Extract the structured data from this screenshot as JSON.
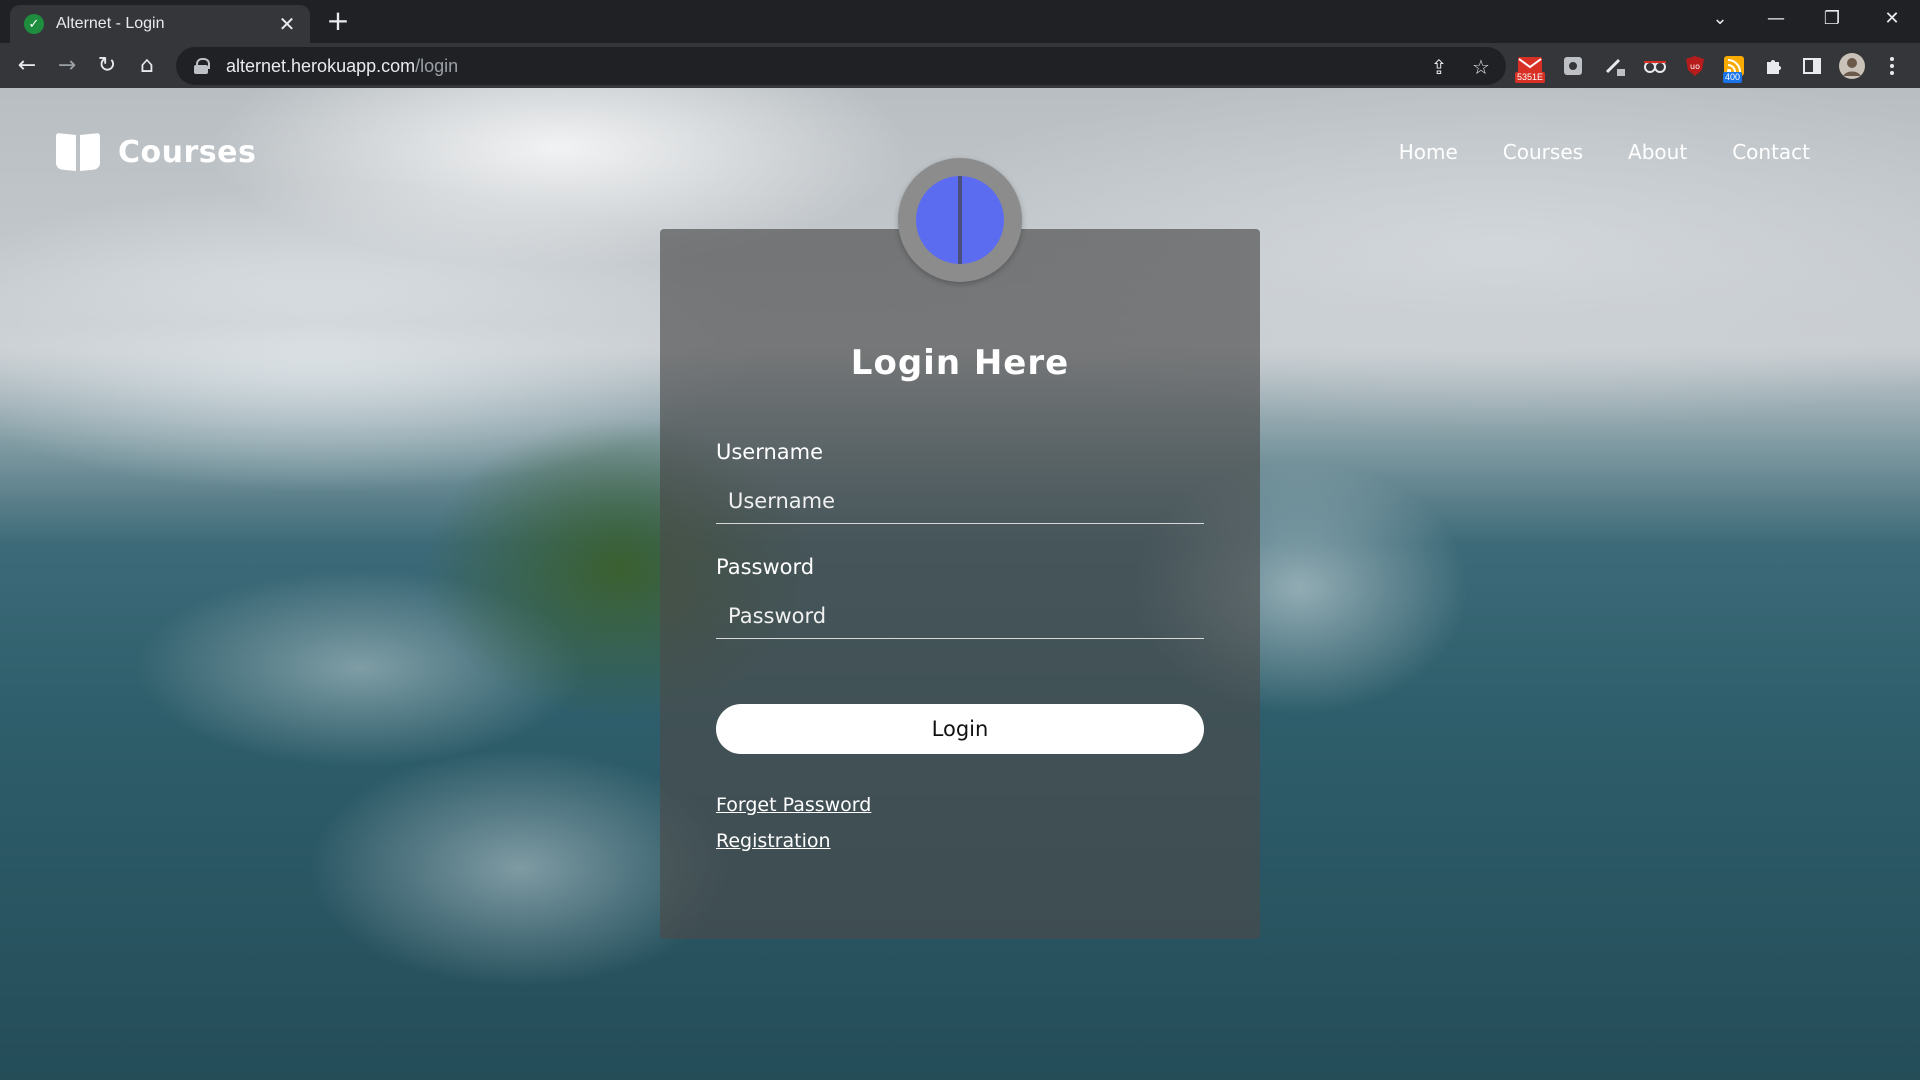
{
  "browser": {
    "tab_title": "Alternet - Login",
    "new_tab_symbol": "+",
    "tab_close_symbol": "✕",
    "url_host": "alternet.herokuapp.com",
    "url_path": "/login",
    "extensions": [
      {
        "icon": "gmail-checker-icon",
        "badge": "5351E",
        "badge_color": "#d93025"
      },
      {
        "icon": "screenshot-extension-icon",
        "badge": ""
      },
      {
        "icon": "pen-tool-extension-icon",
        "badge": ""
      },
      {
        "icon": "glasses-extension-icon",
        "badge": ""
      },
      {
        "icon": "ublock-origin-icon",
        "badge": ""
      },
      {
        "icon": "rss-feed-extension-icon",
        "badge": "400",
        "badge_color": "#1a73e8"
      },
      {
        "icon": "extensions-puzzle-icon",
        "badge": ""
      },
      {
        "icon": "side-panel-icon",
        "badge": ""
      },
      {
        "icon": "profile-avatar-icon",
        "badge": ""
      },
      {
        "icon": "kebab-menu-icon",
        "badge": ""
      }
    ]
  },
  "site": {
    "logo_text": "Courses",
    "nav": [
      "Home",
      "Courses",
      "About",
      "Contact"
    ]
  },
  "login": {
    "title": "Login Here",
    "username_label": "Username",
    "username_placeholder": "Username",
    "password_label": "Password",
    "password_placeholder": "Password",
    "submit_label": "Login",
    "forgot_link": "Forget Password",
    "register_link": "Registration",
    "avatar_color": "#5b6cf0"
  }
}
